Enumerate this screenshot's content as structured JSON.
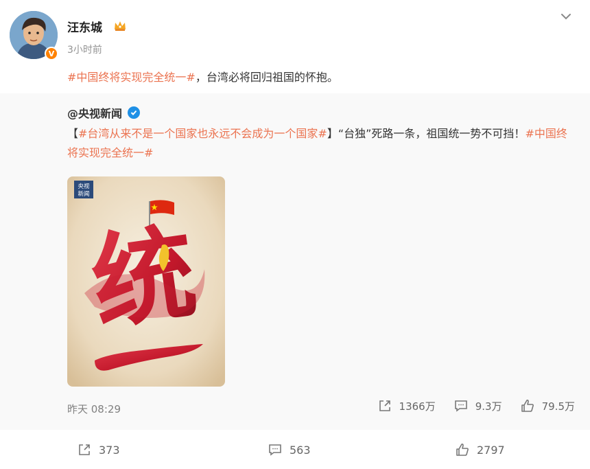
{
  "post": {
    "username": "汪东城",
    "time": "3小时前",
    "text_hashtag": "#中国终将实现完全统一#",
    "text_rest": "，台湾必将回归祖国的怀抱。"
  },
  "repost": {
    "author": "@央视新闻",
    "text": {
      "bracket_open": "【",
      "hashtag1": "#台湾从来不是一个国家也永远不会成为一个国家#",
      "middle": "】“台独”死路一条，祖国统一势不可挡！",
      "hashtag2": "#中国终将实现完全统一#"
    },
    "image": {
      "logo_line1": "央视",
      "logo_line2": "新闻",
      "calligraphy_char1": "统",
      "calligraphy_char2": "一"
    },
    "date": "昨天 08:29",
    "stats": {
      "reposts": "1366万",
      "comments": "9.3万",
      "likes": "79.5万"
    }
  },
  "toolbar": {
    "reposts": "373",
    "comments": "563",
    "likes": "2797"
  },
  "colors": {
    "hashtag": "#eb7350",
    "orange_badge": "#ff8200",
    "blue_verified": "#1f90e6",
    "repost_bg": "#f9f9f9"
  }
}
